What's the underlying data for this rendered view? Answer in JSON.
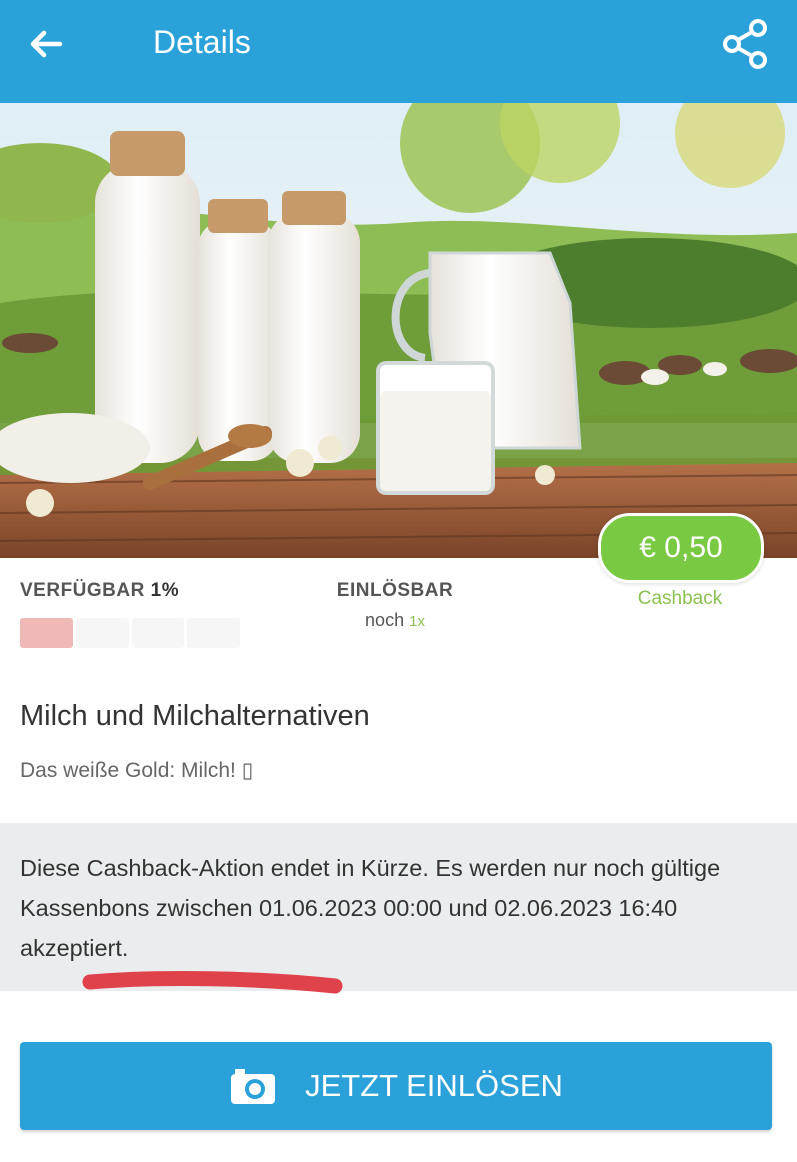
{
  "header": {
    "title": "Details"
  },
  "offer": {
    "cashback_value": "€ 0,50",
    "cashback_label": "Cashback",
    "available_label": "VERFÜGBAR",
    "available_percent": "1%",
    "available_fraction": 0.01,
    "redeemable_label": "EINLÖSBAR",
    "redeemable_prefix": "noch",
    "redeemable_count": "1x"
  },
  "product": {
    "name": "Milch und Milchalternativen",
    "tagline": "Das weiße Gold: Milch! ▯"
  },
  "notice": {
    "text": "Diese Cashback-Aktion endet in Kürze. Es werden nur noch gültige Kassenbons zwischen 01.06.2023 00:00 und 02.06.2023 16:40 akzeptiert."
  },
  "cta": {
    "label": "JETZT EINLÖSEN"
  },
  "colors": {
    "primary": "#2ba1da",
    "green": "#7ac943",
    "annotation": "#e0424b"
  }
}
